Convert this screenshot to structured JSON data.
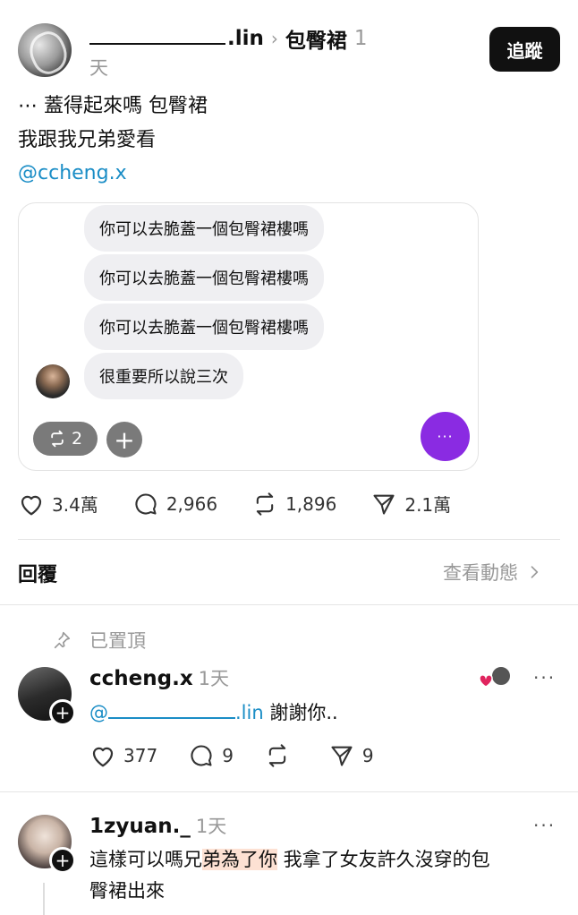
{
  "post": {
    "author_suffix": ".lin",
    "topic": "包臀裙",
    "time_number": "1",
    "time_unit": "天",
    "follow_label": "追蹤",
    "text_lines": [
      "⋯ 蓋得起來嗎 包臀裙",
      "我跟我兄弟愛看"
    ],
    "mention": "@ccheng.x"
  },
  "card": {
    "bubbles": [
      "你可以去脆蓋一個包臀裙樓嗎",
      "你可以去脆蓋一個包臀裙樓嗎",
      "你可以去脆蓋一個包臀裙樓嗎",
      "很重要所以說三次"
    ],
    "reshare_count": "2",
    "plus": "+",
    "more": "···"
  },
  "stats": {
    "likes": "3.4萬",
    "comments": "2,966",
    "reposts": "1,896",
    "shares": "2.1萬"
  },
  "replies": {
    "title": "回覆",
    "view_activity": "查看動態",
    "pinned_label": "已置頂"
  },
  "comments": [
    {
      "user": "ccheng.x",
      "time": "1天",
      "mention_prefix": "@",
      "mention_suffix": ".lin",
      "text": " 謝謝你..",
      "likes": "377",
      "replies": "9",
      "shares": "9",
      "more": "···"
    },
    {
      "user": "1zyuan._",
      "time": "1天",
      "text_a": "這樣可以嗎兄",
      "text_hl": "弟為了你",
      "text_b": " 我拿了女友許久沒穿的包",
      "text_line2": "臀裙出來",
      "more": "···"
    }
  ],
  "colors": {
    "mention": "#1a8dc6",
    "follow_bg": "#111111",
    "purple_button": "#8a2be2",
    "highlight": "#fde1d3",
    "heart_red": "#e0245e"
  }
}
